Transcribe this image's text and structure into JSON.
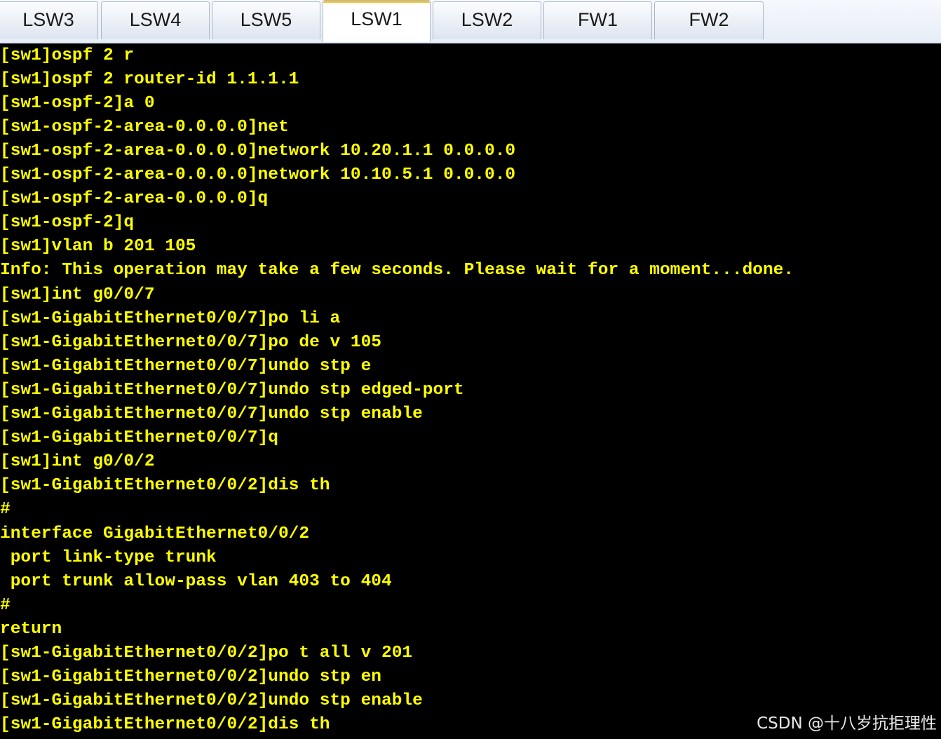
{
  "tabs": [
    {
      "label": "LSW3",
      "active": false
    },
    {
      "label": "LSW4",
      "active": false
    },
    {
      "label": "LSW5",
      "active": false
    },
    {
      "label": "LSW1",
      "active": true
    },
    {
      "label": "LSW2",
      "active": false
    },
    {
      "label": "FW1",
      "active": false
    },
    {
      "label": "FW2",
      "active": false
    }
  ],
  "terminal": {
    "text_color": "#ffff00",
    "background": "#000000",
    "lines": [
      "[sw1]ospf 2 r",
      "[sw1]ospf 2 router-id 1.1.1.1",
      "[sw1-ospf-2]a 0",
      "[sw1-ospf-2-area-0.0.0.0]net",
      "[sw1-ospf-2-area-0.0.0.0]network 10.20.1.1 0.0.0.0",
      "[sw1-ospf-2-area-0.0.0.0]network 10.10.5.1 0.0.0.0",
      "[sw1-ospf-2-area-0.0.0.0]q",
      "[sw1-ospf-2]q",
      "[sw1]vlan b 201 105",
      "Info: This operation may take a few seconds. Please wait for a moment...done.",
      "[sw1]int g0/0/7",
      "[sw1-GigabitEthernet0/0/7]po li a",
      "[sw1-GigabitEthernet0/0/7]po de v 105",
      "[sw1-GigabitEthernet0/0/7]undo stp e",
      "[sw1-GigabitEthernet0/0/7]undo stp edged-port",
      "[sw1-GigabitEthernet0/0/7]undo stp enable",
      "[sw1-GigabitEthernet0/0/7]q",
      "[sw1]int g0/0/2",
      "[sw1-GigabitEthernet0/0/2]dis th",
      "#",
      "interface GigabitEthernet0/0/2",
      " port link-type trunk",
      " port trunk allow-pass vlan 403 to 404",
      "#",
      "return",
      "[sw1-GigabitEthernet0/0/2]po t all v 201",
      "[sw1-GigabitEthernet0/0/2]undo stp en",
      "[sw1-GigabitEthernet0/0/2]undo stp enable",
      "[sw1-GigabitEthernet0/0/2]dis th"
    ]
  },
  "watermark": "CSDN @十八岁抗拒理性"
}
